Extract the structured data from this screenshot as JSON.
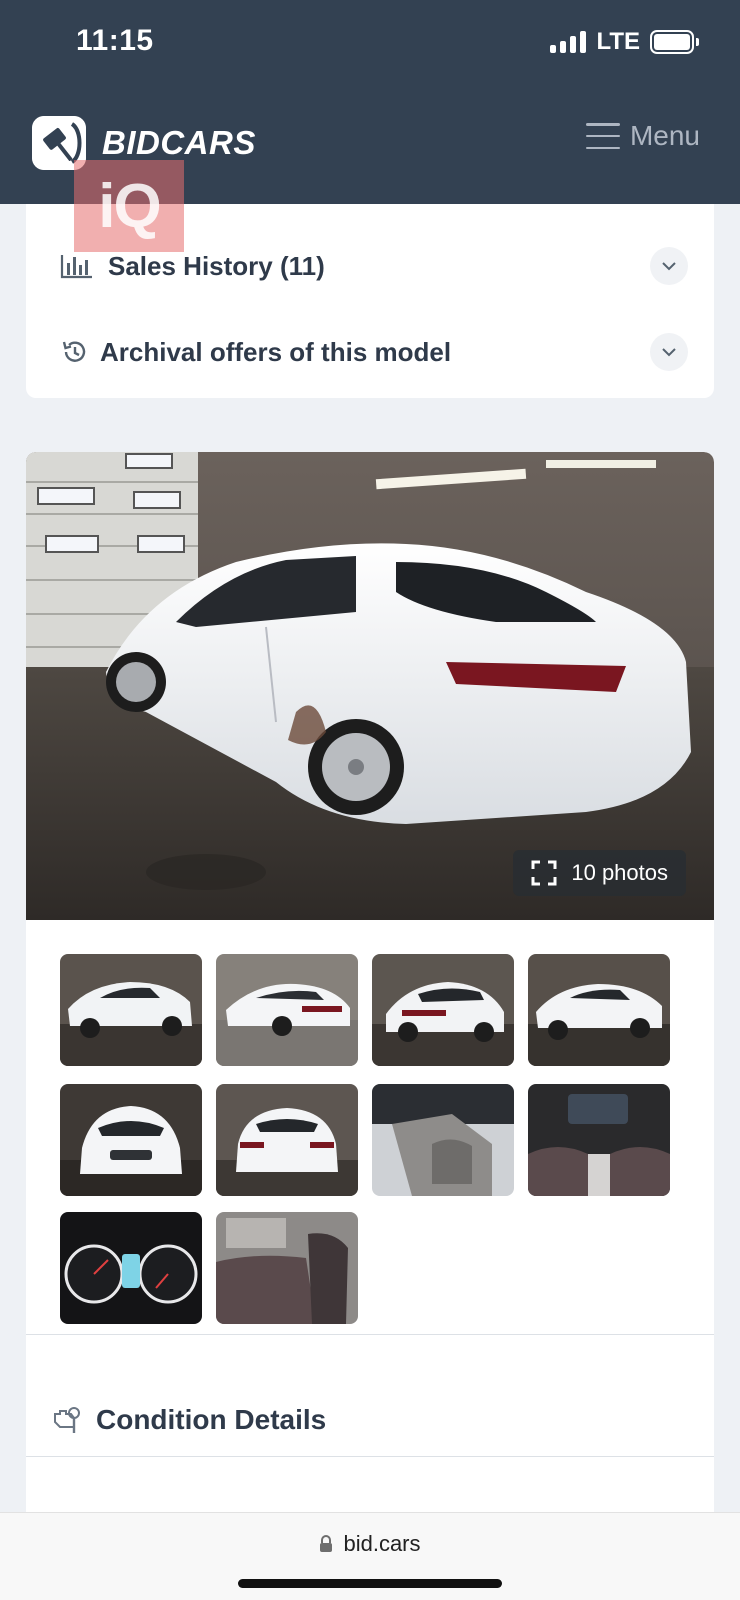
{
  "status_bar": {
    "time": "11:15",
    "network": "LTE"
  },
  "header": {
    "brand": "BIDCARS",
    "menu_label": "Menu",
    "watermark": "iQ"
  },
  "accordion": [
    {
      "icon": "bar-chart-icon",
      "label": "Sales History (11)"
    },
    {
      "icon": "history-icon",
      "label": "Archival offers of this model"
    }
  ],
  "gallery": {
    "photo_count_label": "10 photos",
    "thumbnails": [
      "front-left-exterior",
      "rear-left-exterior",
      "rear-right-exterior",
      "front-left-exterior-2",
      "front-exterior",
      "rear-exterior",
      "driver-interior",
      "dashboard-interior",
      "instrument-cluster",
      "rear-seat-interior"
    ]
  },
  "condition": {
    "label": "Condition Details",
    "icon": "engine-wrench-icon"
  },
  "browser": {
    "url": "bid.cars"
  },
  "colors": {
    "header_bg": "#334152",
    "page_bg": "#eef1f5",
    "text_dark": "#2f3a4a",
    "card_bg": "#ffffff"
  }
}
